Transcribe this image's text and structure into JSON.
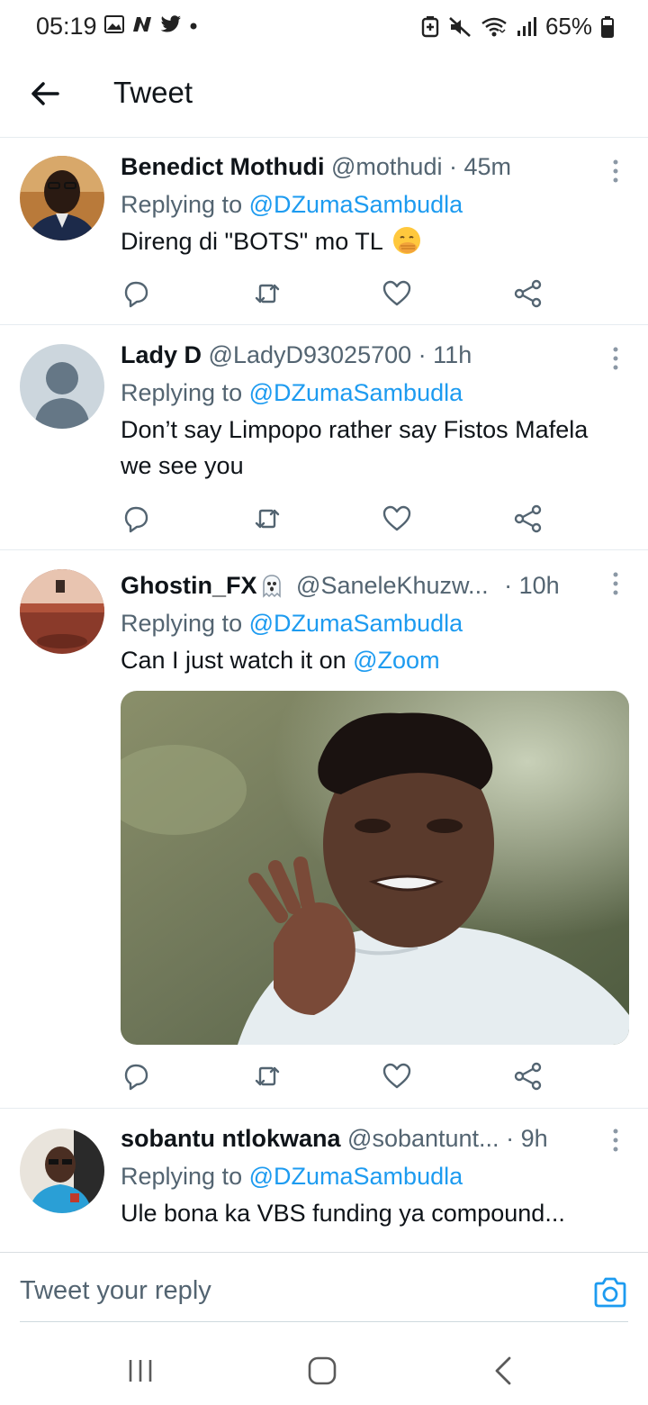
{
  "status_bar": {
    "time": "05:19",
    "left_icons": [
      "gallery-icon",
      "n-icon",
      "twitter-bird-icon",
      "dot-icon"
    ],
    "right_icons": [
      "battery-saver-icon",
      "mute-icon",
      "wifi-icon",
      "signal-icon"
    ],
    "battery": "65%"
  },
  "header": {
    "back_icon": "arrow-left-icon",
    "title": "Tweet"
  },
  "tweets": [
    {
      "name": "Benedict Mothudi",
      "handle": "@mothudi",
      "dot": "·",
      "time": "45m",
      "replying_prefix": "Replying to",
      "replying_to": "@DZumaSambudla",
      "text": "Direng di \"BOTS\" mo TL",
      "emoji": "face-with-hand-over-mouth"
    },
    {
      "name": "Lady D",
      "handle": "@LadyD93025700",
      "dot": "·",
      "time": "11h",
      "replying_prefix": "Replying to",
      "replying_to": "@DZumaSambudla",
      "text": "Don’t say Limpopo rather say Fistos Mafela we see you"
    },
    {
      "name": "Ghostin_FX",
      "name_emoji": "ghost-icon",
      "handle": "@SaneleKhuzw...",
      "dot": "·",
      "time": "10h",
      "replying_prefix": "Replying to",
      "replying_to": "@DZumaSambudla",
      "text_prefix": "Can I just watch it on",
      "text_mention": "@Zoom",
      "media": "meme photo of man in white shirt raising hand"
    },
    {
      "name": "sobantu ntlokwana",
      "handle": "@sobantunt...",
      "dot": "·",
      "time": "9h",
      "replying_prefix": "Replying to",
      "replying_to": "@DZumaSambudla",
      "text": "Ule bona ka VBS funding ya compound..."
    }
  ],
  "actions": [
    "reply-icon",
    "retweet-icon",
    "like-icon",
    "share-icon"
  ],
  "reply_bar": {
    "placeholder": "Tweet your reply",
    "camera_icon": "camera-icon"
  },
  "nav_bar": [
    "recents-icon",
    "home-icon",
    "back-icon"
  ],
  "colors": {
    "accent": "#1d9bf0",
    "text_primary": "#0f1419",
    "text_secondary": "#536471",
    "divider": "#e6ecf0"
  }
}
